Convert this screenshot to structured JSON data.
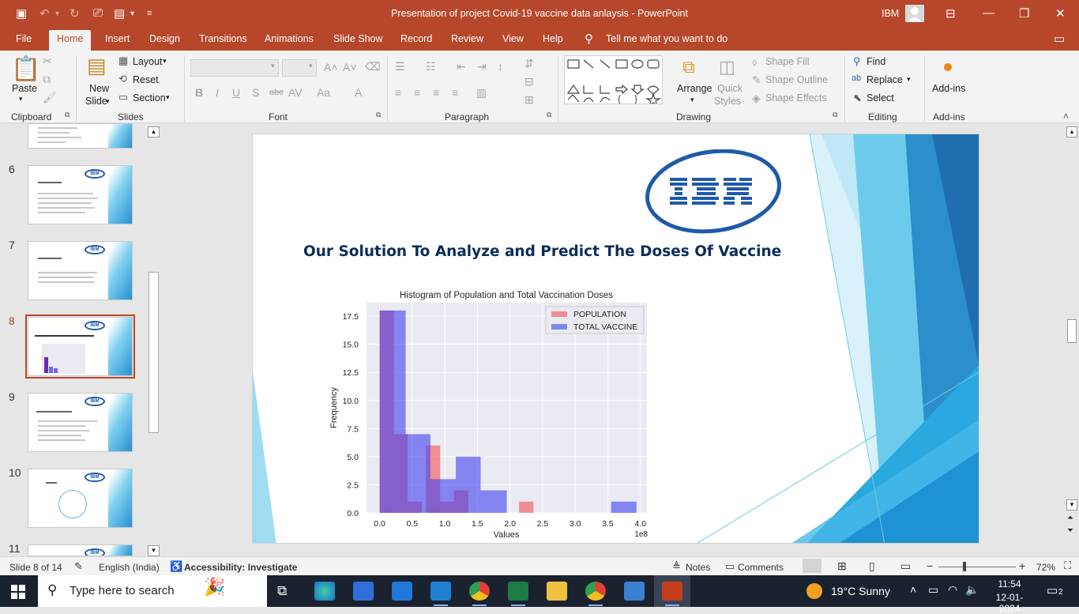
{
  "window": {
    "title": "Presentation of project Covid-19 vaccine data anlaysis  -  PowerPoint",
    "user": "IBM"
  },
  "tabs": [
    "File",
    "Home",
    "Insert",
    "Design",
    "Transitions",
    "Animations",
    "Slide Show",
    "Record",
    "Review",
    "View",
    "Help"
  ],
  "tell_me": "Tell me what you want to do",
  "ribbon": {
    "clipboard": {
      "label": "Clipboard",
      "paste": "Paste"
    },
    "slides": {
      "label": "Slides",
      "new_slide_1": "New",
      "new_slide_2": "Slide",
      "layout": "Layout",
      "reset": "Reset",
      "section": "Section"
    },
    "font": {
      "label": "Font"
    },
    "paragraph": {
      "label": "Paragraph"
    },
    "drawing": {
      "label": "Drawing",
      "arrange": "Arrange",
      "quick_styles_1": "Quick",
      "quick_styles_2": "Styles",
      "shape_fill": "Shape Fill",
      "shape_outline": "Shape Outline",
      "shape_effects": "Shape Effects"
    },
    "editing": {
      "label": "Editing",
      "find": "Find",
      "replace": "Replace",
      "select": "Select"
    },
    "addins": {
      "label": "Add-ins",
      "button": "Add-ins"
    }
  },
  "thumbnails": [
    {
      "number": "6",
      "title": "How IT can help people"
    },
    {
      "number": "7",
      "title": "Data set Description"
    },
    {
      "number": "8",
      "title": "Our Solution To Analyze and Predict The Doses Of Vaccine",
      "selected": true
    },
    {
      "number": "9",
      "title": "What makes your solution unique"
    },
    {
      "number": "10",
      "title": "Modeling"
    },
    {
      "number": "11",
      "title": ""
    }
  ],
  "slide": {
    "title": "Our Solution To Analyze and Predict The Doses Of Vaccine",
    "logo_text": "IBM"
  },
  "chart_data": {
    "type": "bar",
    "title": "Histogram of Population and Total Vaccination Doses",
    "xlabel": "Values",
    "ylabel": "Frequency",
    "x_scale_note": "1e8",
    "xlim": [
      -0.2,
      4.1
    ],
    "ylim": [
      0,
      18.7
    ],
    "xticks": [
      "0.0",
      "0.5",
      "1.0",
      "1.5",
      "2.0",
      "2.5",
      "3.0",
      "3.5",
      "4.0"
    ],
    "yticks": [
      "0.0",
      "2.5",
      "5.0",
      "7.5",
      "10.0",
      "12.5",
      "15.0",
      "17.5"
    ],
    "legend_position": "top-right",
    "grid": true,
    "series": [
      {
        "name": "POPULATION",
        "color": "#f05050",
        "bins": [
          [
            0.0,
            0.22,
            18
          ],
          [
            0.22,
            0.43,
            7
          ],
          [
            0.43,
            0.65,
            1
          ],
          [
            0.71,
            0.93,
            6
          ],
          [
            0.93,
            1.14,
            1
          ],
          [
            1.14,
            1.36,
            2
          ],
          [
            2.14,
            2.36,
            1
          ]
        ]
      },
      {
        "name": "TOTAL VACCINE",
        "color": "#4040f0",
        "bins": [
          [
            0.0,
            0.4,
            18
          ],
          [
            0.4,
            0.78,
            7
          ],
          [
            0.78,
            1.17,
            3
          ],
          [
            1.17,
            1.55,
            5
          ],
          [
            1.55,
            1.95,
            2
          ],
          [
            3.55,
            3.94,
            1
          ]
        ]
      }
    ]
  },
  "status": {
    "slide_info": "Slide 8 of 14",
    "language": "English (India)",
    "accessibility": "Accessibility: Investigate",
    "notes": "Notes",
    "comments": "Comments",
    "zoom": "72%"
  },
  "taskbar": {
    "search_placeholder": "Type here to search",
    "weather": "19°C  Sunny",
    "time": "11:54",
    "date": "12-01-2024",
    "notifications": "2"
  }
}
